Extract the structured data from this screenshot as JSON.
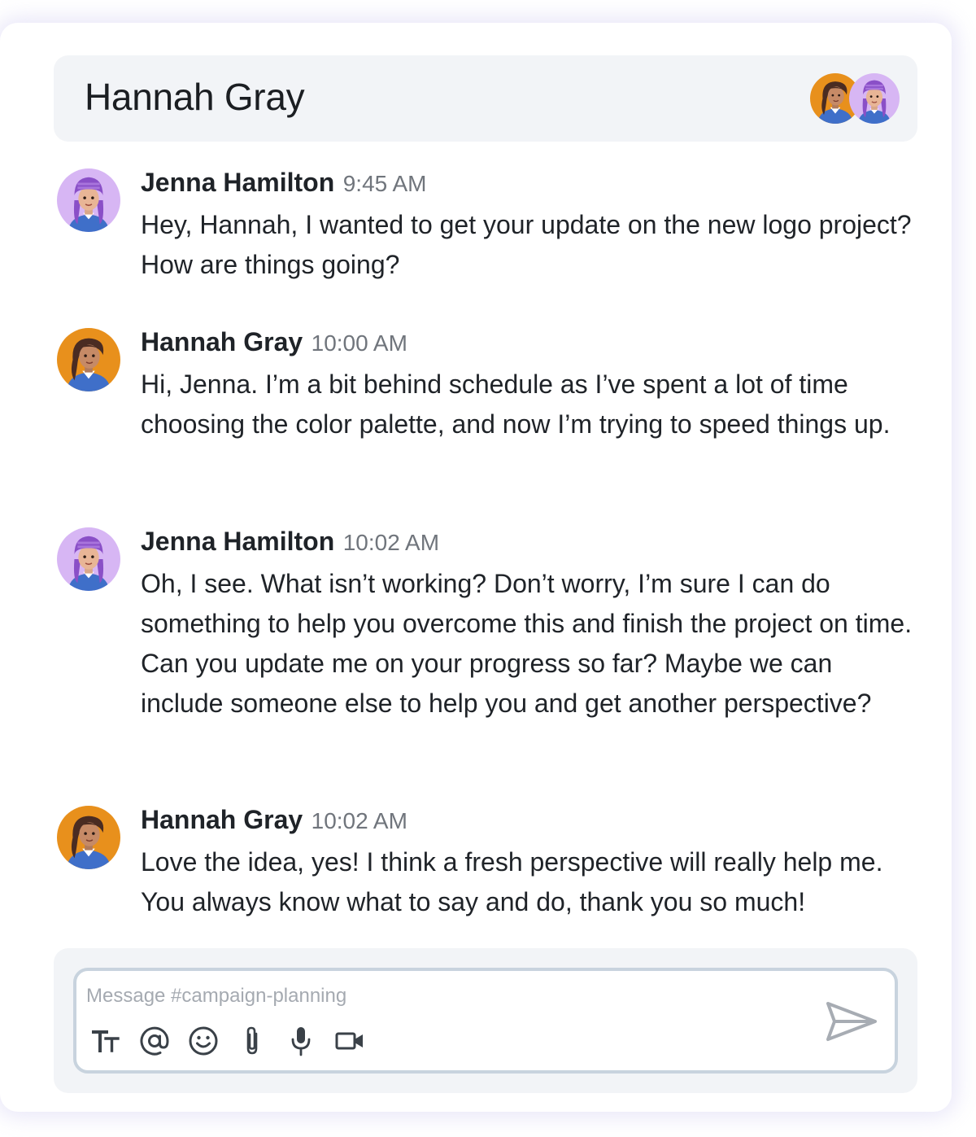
{
  "conversation": {
    "title": "Hannah Gray",
    "participants": [
      "Hannah Gray",
      "Jenna Hamilton"
    ]
  },
  "messages": [
    {
      "author": "Jenna Hamilton",
      "time": "9:45 AM",
      "text": "Hey, Hannah, I wanted to get your update on the new logo project? How are things going?"
    },
    {
      "author": "Hannah Gray",
      "time": "10:00 AM",
      "text": "Hi, Jenna. I’m a bit behind schedule as I’ve spent a lot of time choosing the color palette, and now I’m trying to speed things up."
    },
    {
      "author": "Jenna Hamilton",
      "time": "10:02 AM",
      "text": "Oh, I see. What isn’t working? Don’t worry, I’m sure I can do something to help you overcome this and finish the project on time. Can you update me on your progress so far? Maybe we can include someone else to help you and get another perspective?"
    },
    {
      "author": "Hannah Gray",
      "time": "10:02 AM",
      "text": "Love the idea, yes! I think a fresh perspective will really help me. You always know what to say and do, thank you so much!"
    }
  ],
  "composer": {
    "placeholder": "Message #campaign-planning",
    "value": "",
    "tools": [
      "text-format-icon",
      "mention-icon",
      "emoji-icon",
      "attachment-icon",
      "microphone-icon",
      "video-icon"
    ],
    "send_icon": "send-icon"
  },
  "colors": {
    "header_bg": "#f2f4f7",
    "hannah_avatar_bg": "#e8901c",
    "jenna_avatar_bg": "#d7b6f4",
    "composer_border": "#c8d3de"
  }
}
